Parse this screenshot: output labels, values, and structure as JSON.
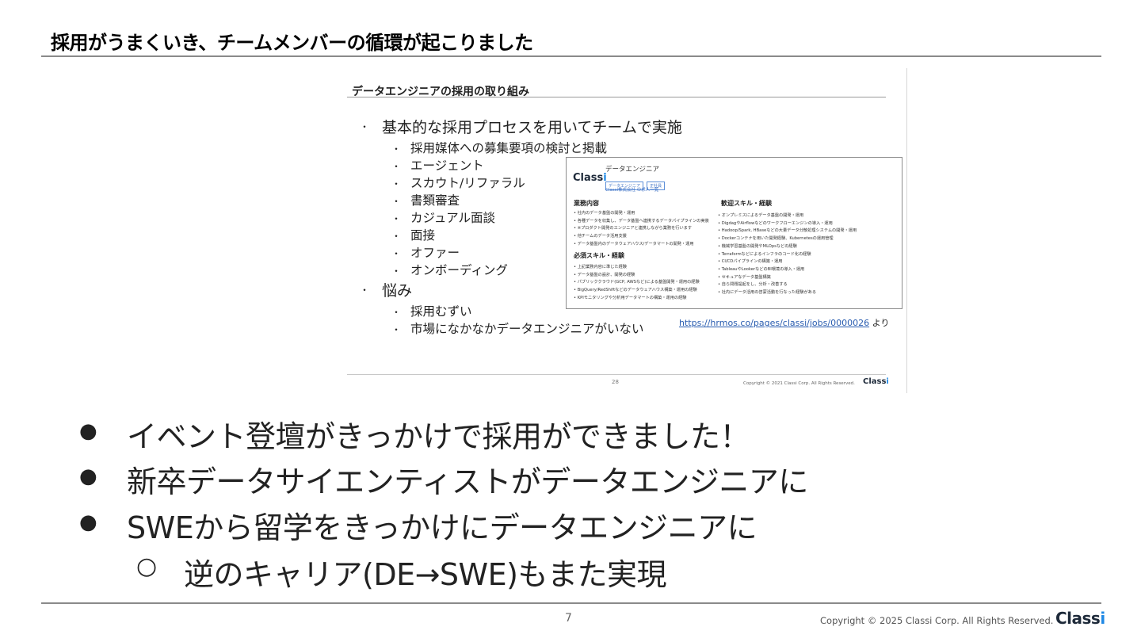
{
  "slide": {
    "title": "採用がうまくいき、チームメンバーの循環が起こりました",
    "page_number": "7",
    "copyright": "Copyright © 2025 Classi Corp. All Rights Reserved.",
    "logo_text": "Class",
    "logo_i": "i"
  },
  "embedded": {
    "title": "データエンジニアの採用の取り組み",
    "items": [
      {
        "text": "基本的な採用プロセスを用いてチームで実施"
      },
      {
        "text": "採用媒体への募集要項の検討と掲載"
      },
      {
        "text": "エージェント"
      },
      {
        "text": "スカウト/リファラル"
      },
      {
        "text": "書類審査"
      },
      {
        "text": "カジュアル面談"
      },
      {
        "text": "面接"
      },
      {
        "text": "オファー"
      },
      {
        "text": "オンボーディング"
      },
      {
        "text": "悩み"
      },
      {
        "text": "採用むずい"
      },
      {
        "text": "市場になかなかデータエンジニアがいない"
      }
    ],
    "job": {
      "logo_text": "Class",
      "logo_i": "i",
      "title": "データエンジニア",
      "tags": [
        "データエンジニア",
        "正社員"
      ],
      "company": "Classi株式会社 の求人一覧",
      "h_duties": "業務内容",
      "duties": [
        "社内のデータ基盤の開発・運用",
        "各種データを収集し、データ基盤へ連携するデータパイプラインの実装",
        "※プロダクト開発のエンジニアと連携しながら業務を行います",
        "他チームのデータ活用支援",
        "データ基盤内のデータウェアハウス/データマートの開発・運用"
      ],
      "h_required": "必須スキル・経験",
      "required": [
        "上記業務内容に準じた経験",
        "データ基盤の設計、開発の経験",
        "パブリッククラウド(GCP, AWSなど)による基盤開発・運用の経験",
        "BigQuery/RedShiftなどのデータウェアハウス構築・運用の経験",
        "KPIモニタリングや分析用データマートの構築・運用の経験"
      ],
      "h_welcome": "歓迎スキル・経験",
      "welcome": [
        "オンプレミスによるデータ基盤の開発・運用",
        "DigdagやAirflowなどのワークフローエンジンの導入・運用",
        "Hadoop/Spark, HBaseなどの大量データ分散処理システムの開発・運用",
        "Dockerコンテナを用いた開発経験、Kubernetesの運用管理",
        "機械学習基盤の開発やMLOpsなどの経験",
        "Terraformなどによるインフラのコード化の経験",
        "CI/CDパイプラインの構築・運用",
        "TableauやLookerなどのBI環境の導入・運用",
        "セキュアなデータ基盤構築",
        "自ら問題提起をし、分析・改善する",
        "社内にデータ活用の啓蒙活動を行なった経験がある"
      ]
    },
    "link": "https://hrmos.co/pages/classi/jobs/0000026",
    "link_suffix": "より",
    "page_number": "28",
    "copyright": "Copyright © 2021 Classi Corp. All Rights Reserved.",
    "logo_text": "Class",
    "logo_i": "i"
  },
  "bullets": [
    {
      "marker": "●",
      "text": "イベント登壇がきっかけで採用ができました！"
    },
    {
      "marker": "●",
      "text": "新卒データサイエンティストがデータエンジニアに"
    },
    {
      "marker": "●",
      "text": "SWEから留学をきっかけにデータエンジニアに"
    },
    {
      "marker": "○",
      "text": "逆のキャリア(DE→SWE)もまた実現"
    }
  ]
}
